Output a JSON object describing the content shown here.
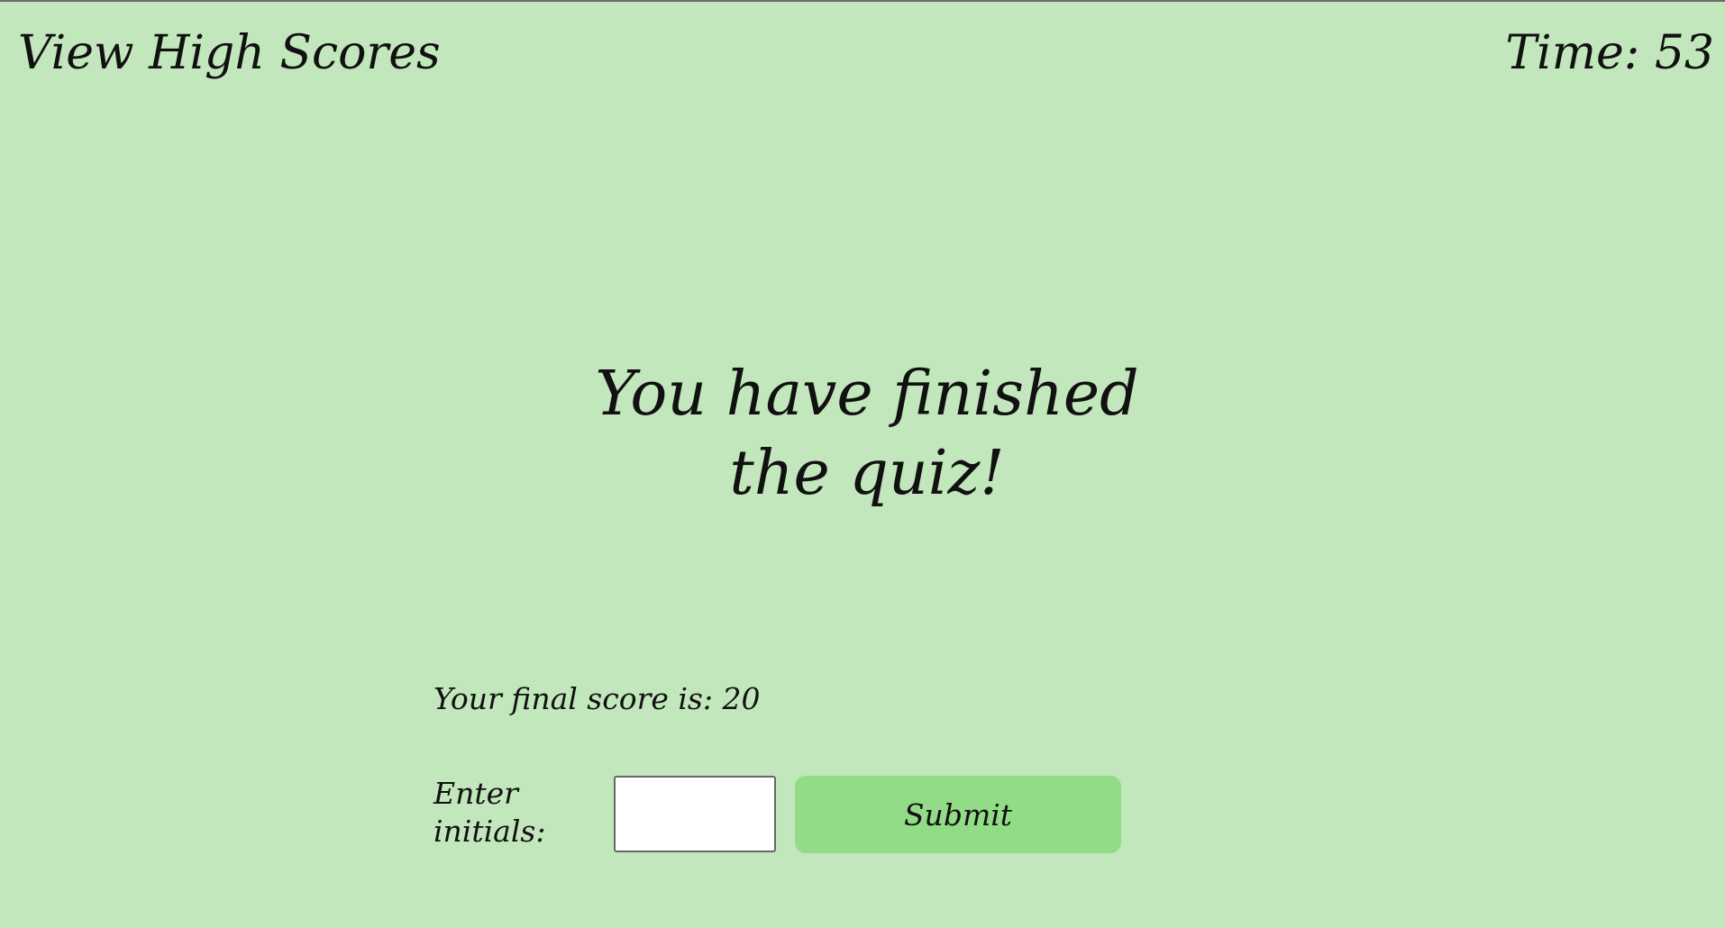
{
  "header": {
    "high_scores_link": "View High Scores",
    "timer_text": "Time: 53"
  },
  "main": {
    "title": "You have finished the quiz!",
    "final_score_text": "Your final score is: 20",
    "initials_label": "Enter initials:",
    "initials_value": "",
    "submit_label": "Submit"
  },
  "colors": {
    "background": "#c3e7bc",
    "button": "#93dc87",
    "text": "#111111"
  }
}
